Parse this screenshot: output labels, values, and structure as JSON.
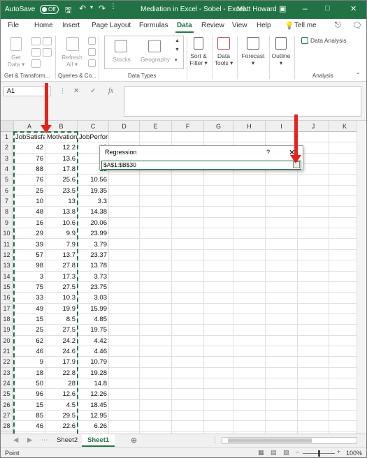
{
  "titlebar": {
    "autosave_label": "AutoSave",
    "autosave_state": "Off",
    "doc_title": "Mediation in Excel - Sobel  -  Excel",
    "user": "Matt Howard"
  },
  "menu": [
    "File",
    "Home",
    "Insert",
    "Page Layout",
    "Formulas",
    "Data",
    "Review",
    "View",
    "Help"
  ],
  "menu_active": "Data",
  "tell_me": "Tell me",
  "ribbon": {
    "get_data": [
      "Get",
      "Data ▾"
    ],
    "refresh_all": [
      "Refresh",
      "All ▾"
    ],
    "stocks": "Stocks",
    "geography": "Geography",
    "sort_filter": [
      "Sort &",
      "Filter ▾"
    ],
    "data_tools": [
      "Data",
      "Tools ▾"
    ],
    "forecast": [
      "Forecast",
      "▾"
    ],
    "outline": [
      "Outline",
      "▾"
    ],
    "data_analysis": "Data Analysis",
    "groups": [
      "Get & Transform...",
      "Queries & Co...",
      "Data Types",
      "Analysis"
    ]
  },
  "formula_bar": {
    "name_box": "A1",
    "formula": ""
  },
  "columns": [
    "A",
    "B",
    "C",
    "D",
    "E",
    "F",
    "G",
    "H",
    "I",
    "J",
    "K"
  ],
  "headers": [
    "JobSatisfaction",
    "Motivation",
    "JobPerformance"
  ],
  "rows": [
    [
      42,
      12.2,
      18.0
    ],
    [
      76,
      13.6,
      12.0
    ],
    [
      88,
      17.8,
      13.0
    ],
    [
      76,
      25.6,
      10.56
    ],
    [
      25,
      23.5,
      19.35
    ],
    [
      10,
      13,
      3.3
    ],
    [
      48,
      13.8,
      14.38
    ],
    [
      16,
      10.6,
      20.06
    ],
    [
      29,
      9.9,
      23.99
    ],
    [
      39,
      7.9,
      3.79
    ],
    [
      57,
      13.7,
      23.37
    ],
    [
      98,
      27.8,
      13.78
    ],
    [
      3,
      17.3,
      3.73
    ],
    [
      75,
      27.5,
      23.75
    ],
    [
      33,
      10.3,
      3.03
    ],
    [
      49,
      19.9,
      15.99
    ],
    [
      15,
      8.5,
      4.85
    ],
    [
      25,
      27.5,
      19.75
    ],
    [
      62,
      24.2,
      4.42
    ],
    [
      46,
      24.6,
      4.46
    ],
    [
      9,
      17.9,
      10.79
    ],
    [
      18,
      22.8,
      19.28
    ],
    [
      50,
      28,
      14.8
    ],
    [
      96,
      12.6,
      12.26
    ],
    [
      15,
      4.5,
      18.45
    ],
    [
      85,
      29.5,
      12.95
    ],
    [
      46,
      22.6,
      6.26
    ],
    [
      95,
      17.5,
      3.75
    ],
    [
      81,
      26.1,
      16.61
    ]
  ],
  "display": {
    "A": [
      "42",
      "76",
      "88",
      "76",
      "25",
      "10",
      "48",
      "16",
      "29",
      "39",
      "57",
      "98",
      "3",
      "75",
      "33",
      "49",
      "15",
      "25",
      "62",
      "46",
      "9",
      "18",
      "50",
      "96",
      "15",
      "85",
      "46",
      "95",
      "81"
    ],
    "B": [
      "12.2",
      "13.6",
      "17.8",
      "25.6",
      "23.5",
      "13",
      "13.8",
      "10.6",
      "9.9",
      "7.9",
      "13.7",
      "27.8",
      "17.3",
      "27.5",
      "10.3",
      "19.9",
      "8.5",
      "27.5",
      "24.2",
      "24.6",
      "17.9",
      "22.8",
      "28",
      "12.6",
      "4.5",
      "29.5",
      "22.6",
      "17.5",
      "26.1"
    ],
    "C": [
      "18",
      "12",
      "13",
      "10.56",
      "19.35",
      "3.3",
      "14.38",
      "20.06",
      "23.99",
      "3.79",
      "23.37",
      "13.78",
      "3.73",
      "23.75",
      "3.03",
      "15.99",
      "4.85",
      "19.75",
      "4.42",
      "4.46",
      "10.79",
      "19.28",
      "14.8",
      "12.26",
      "18.45",
      "12.95",
      "6.26",
      "3.75",
      "16.61"
    ]
  },
  "dialog": {
    "title": "Regression",
    "help": "?",
    "close": "✕",
    "ref_value": "$A$1:$B$30"
  },
  "sheet_tabs": [
    "Sheet2",
    "Sheet1"
  ],
  "active_tab": "Sheet1",
  "status": {
    "mode": "Point",
    "zoom": "100%"
  },
  "colors": {
    "excel_green": "#217346",
    "arrow_red": "#E8221B"
  }
}
